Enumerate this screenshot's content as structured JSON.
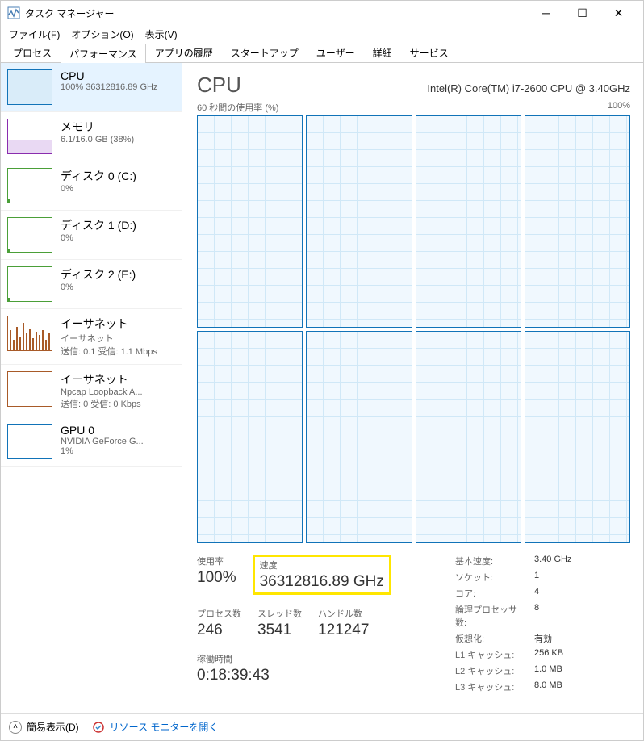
{
  "window": {
    "title": "タスク マネージャー"
  },
  "menu": {
    "file": "ファイル(F)",
    "options": "オプション(O)",
    "view": "表示(V)"
  },
  "tabs": [
    "プロセス",
    "パフォーマンス",
    "アプリの履歴",
    "スタートアップ",
    "ユーザー",
    "詳細",
    "サービス"
  ],
  "sidebar": [
    {
      "title": "CPU",
      "sub": "100%  36312816.89 GHz"
    },
    {
      "title": "メモリ",
      "sub": "6.1/16.0 GB (38%)"
    },
    {
      "title": "ディスク 0 (C:)",
      "sub": "0%"
    },
    {
      "title": "ディスク 1 (D:)",
      "sub": "0%"
    },
    {
      "title": "ディスク 2 (E:)",
      "sub": "0%"
    },
    {
      "title": "イーサネット",
      "sub": "イーサネット",
      "sub2": "送信: 0.1  受信: 1.1 Mbps"
    },
    {
      "title": "イーサネット",
      "sub": "Npcap Loopback A...",
      "sub2": "送信: 0  受信: 0 Kbps"
    },
    {
      "title": "GPU 0",
      "sub": "NVIDIA GeForce G...",
      "sub2": "1%"
    }
  ],
  "main": {
    "heading": "CPU",
    "model": "Intel(R) Core(TM) i7-2600 CPU @ 3.40GHz",
    "graphLabelLeft": "60 秒間の使用率 (%)",
    "graphLabelRight": "100%",
    "stats": {
      "usage": {
        "label": "使用率",
        "value": "100%"
      },
      "speed": {
        "label": "速度",
        "value": "36312816.89 GHz"
      },
      "processes": {
        "label": "プロセス数",
        "value": "246"
      },
      "threads": {
        "label": "スレッド数",
        "value": "3541"
      },
      "handles": {
        "label": "ハンドル数",
        "value": "121247"
      },
      "uptime": {
        "label": "稼働時間",
        "value": "0:18:39:43"
      }
    },
    "specs": [
      {
        "label": "基本速度:",
        "value": "3.40 GHz"
      },
      {
        "label": "ソケット:",
        "value": "1"
      },
      {
        "label": "コア:",
        "value": "4"
      },
      {
        "label": "論理プロセッサ数:",
        "value": "8"
      },
      {
        "label": "仮想化:",
        "value": "有効"
      },
      {
        "label": "L1 キャッシュ:",
        "value": "256 KB"
      },
      {
        "label": "L2 キャッシュ:",
        "value": "1.0 MB"
      },
      {
        "label": "L3 キャッシュ:",
        "value": "8.0 MB"
      }
    ]
  },
  "footer": {
    "simple": "簡易表示(D)",
    "resmon": "リソース モニターを開く"
  }
}
